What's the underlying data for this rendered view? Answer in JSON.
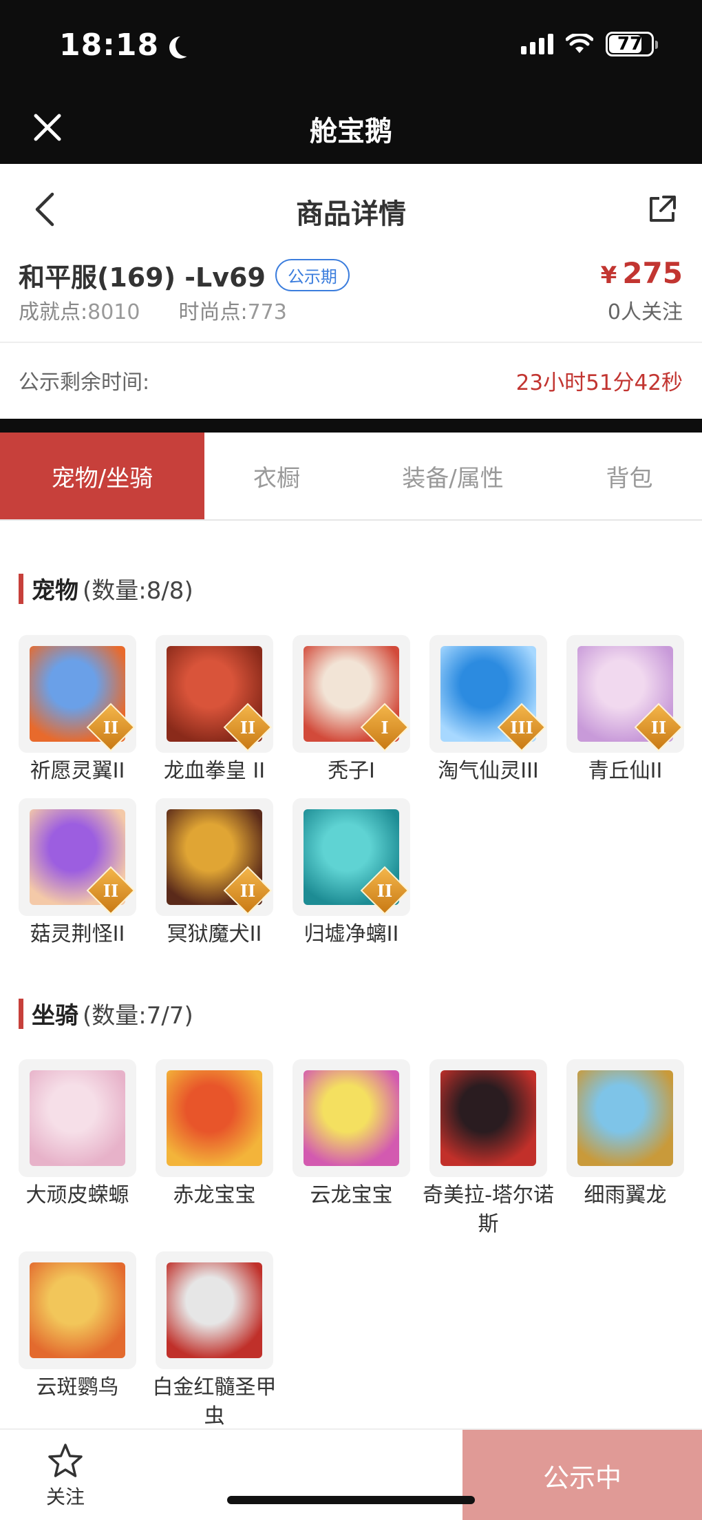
{
  "status_bar": {
    "time": "18:18",
    "battery": "77"
  },
  "webview": {
    "title": "舱宝鹅"
  },
  "nav": {
    "title": "商品详情"
  },
  "product": {
    "title": "和平服(169) -Lv69",
    "badge": "公示期",
    "currency": "¥",
    "price": "275",
    "achievement_label": "成就点:",
    "achievement_value": "8010",
    "fashion_label": "时尚点:",
    "fashion_value": "773",
    "followers": "0人关注"
  },
  "countdown": {
    "label": "公示剩余时间:",
    "value": "23小时51分42秒"
  },
  "tabs": [
    {
      "label": "宠物/坐骑",
      "active": true
    },
    {
      "label": "衣橱",
      "active": false
    },
    {
      "label": "装备/属性",
      "active": false
    },
    {
      "label": "背包",
      "active": false
    }
  ],
  "pets": {
    "title": "宠物",
    "count": "(数量:8/8)",
    "items": [
      {
        "name": "祈愿灵翼II",
        "grade": "II",
        "colors": [
          "#6aa0e8",
          "#e86a2c"
        ]
      },
      {
        "name": "龙血拳皇 II",
        "grade": "II",
        "colors": [
          "#d9543a",
          "#8a2a1a"
        ]
      },
      {
        "name": "秃子I",
        "grade": "I",
        "colors": [
          "#f2e4d6",
          "#d24a3a"
        ]
      },
      {
        "name": "淘气仙灵III",
        "grade": "III",
        "colors": [
          "#2c8be0",
          "#a7d8ff"
        ]
      },
      {
        "name": "青丘仙II",
        "grade": "II",
        "colors": [
          "#f1d9ef",
          "#c89ad9"
        ]
      },
      {
        "name": "菇灵荆怪II",
        "grade": "II",
        "colors": [
          "#9c5ee0",
          "#f4c9a8"
        ]
      },
      {
        "name": "冥狱魔犬II",
        "grade": "II",
        "colors": [
          "#e0a534",
          "#5a2a1a"
        ]
      },
      {
        "name": "归墟净螭II",
        "grade": "II",
        "colors": [
          "#5fd3d3",
          "#1d8c94"
        ]
      }
    ]
  },
  "mounts": {
    "title": "坐骑",
    "count": "(数量:7/7)",
    "items": [
      {
        "name": "大顽皮蝾螈",
        "colors": [
          "#f6dfe8",
          "#e7b2c9"
        ]
      },
      {
        "name": "赤龙宝宝",
        "colors": [
          "#e8552a",
          "#f3b43a"
        ]
      },
      {
        "name": "云龙宝宝",
        "colors": [
          "#f4e060",
          "#d35ab0"
        ]
      },
      {
        "name": "奇美拉-塔尔诺斯",
        "colors": [
          "#2a1c20",
          "#c2302a"
        ]
      },
      {
        "name": "细雨翼龙",
        "colors": [
          "#7ec4e8",
          "#c99a3a"
        ]
      },
      {
        "name": "云斑鹦鸟",
        "colors": [
          "#f2c65a",
          "#e36a2e"
        ]
      },
      {
        "name": "白金红髓圣甲虫",
        "colors": [
          "#e6e6e6",
          "#c0302a"
        ]
      }
    ]
  },
  "bottom": {
    "follow_label": "关注",
    "cta_label": "公示中"
  }
}
